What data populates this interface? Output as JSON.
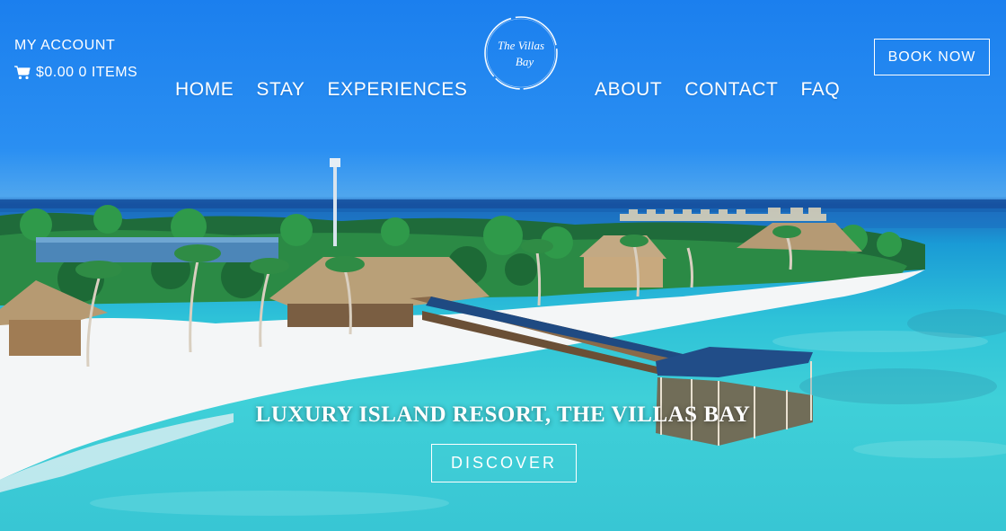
{
  "header": {
    "account_label": "MY ACCOUNT",
    "cart_label": "$0.00 0 ITEMS",
    "cart_icon": "shopping-cart-icon",
    "logo_text_line1": "The Villas",
    "logo_text_line2": "Bay",
    "book_label": "BOOK NOW"
  },
  "nav": {
    "left": [
      "HOME",
      "STAY",
      "EXPERIENCES"
    ],
    "right": [
      "ABOUT",
      "CONTACT",
      "FAQ"
    ]
  },
  "hero": {
    "headline": "LUXURY ISLAND RESORT, THE VILLAS BAY",
    "cta_label": "DISCOVER"
  },
  "colors": {
    "sky": "#1b7fee",
    "lagoon": "#3fd0d8",
    "sand": "#f4f6f7"
  }
}
